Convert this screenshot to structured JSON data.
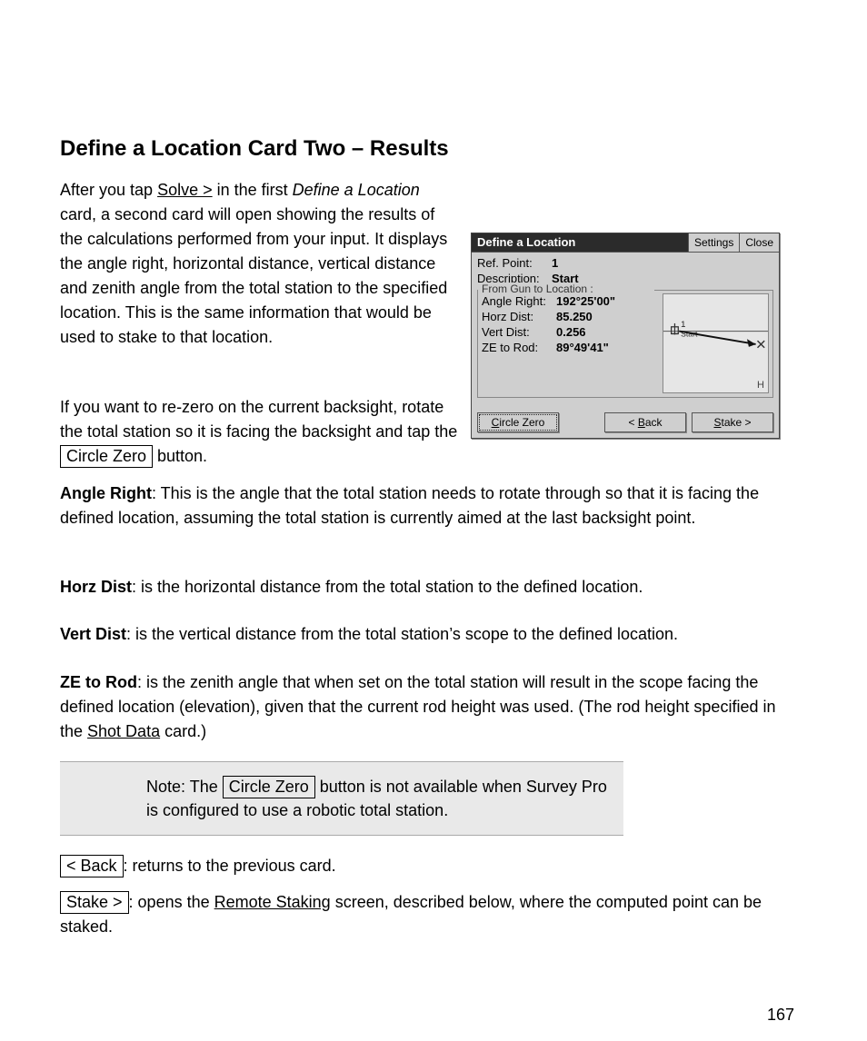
{
  "heading1": "Define a Location Card Two – Results",
  "p1_a": "After you tap ",
  "p1_link": "Solve >",
  "p1_b": " in the first ",
  "p1_c": "Define a Location",
  "p1_d": " card, a second card will open showing the results of the calculations performed from your input. It displays the angle right, horizontal distance, vertical distance and zenith angle from the total station to the specified location. This is the same information that would be used to stake to that location.",
  "p2_a": "If you want to re-zero on the current backsight, rotate the total station so it is facing the backsight and tap the ",
  "p2_b": " button. ",
  "p3_title": "Angle Right",
  "p3_body": ": This is the angle that the total station needs to rotate through so that it is facing the defined location, assuming the total station is currently aimed at the last backsight point.",
  "p4_title": "Horz Dist",
  "p4_body": ": is the horizontal distance from the total station to the defined location.",
  "p5_title": "Vert Dist",
  "p5_body": ": is the vertical distance from the total station’s scope to the defined location.",
  "p6_title": "ZE to Rod",
  "p6_body": ": is the zenith angle that when set on the total station will result in the scope facing the defined location (elevation), given that the current rod height was used. (The rod height specified in the ",
  "p6_link": "Shot Data",
  "p6_tail": " card.)",
  "note_a": "Note: The ",
  "note_b": " button is not available when Survey Pro is configured to use a robotic total station.",
  "back_a": ": returns to the previous card.",
  "stake_a": ": opens the ",
  "stake_link": "Remote Staking",
  "stake_b": " screen, described below, where the computed point can be staked.",
  "btn_circle_zero": "Circle Zero",
  "btn_back_ref": "< Back",
  "btn_stake_ref": "Stake >",
  "win": {
    "title": "Define a Location",
    "settings": "Settings",
    "close": "Close",
    "ref_label": "Ref. Point:",
    "ref_value": "1",
    "desc_label": "Description:",
    "desc_value": "Start",
    "group_title": "From Gun to Location :",
    "angle_label": "Angle Right:",
    "angle_value": "192°25'00\"",
    "hd_label": "Horz Dist:",
    "hd_value": "85.250",
    "vd_label": "Vert Dist:",
    "vd_value": "0.256",
    "ze_label": "ZE to Rod:",
    "ze_value": "89°49'41\"",
    "map_point_label": "1",
    "map_point_text": "Start",
    "map_h": "H",
    "btn_circle": "Circle Zero",
    "btn_back": "< Back",
    "btn_stake": "Stake >"
  },
  "page_footer": "167"
}
